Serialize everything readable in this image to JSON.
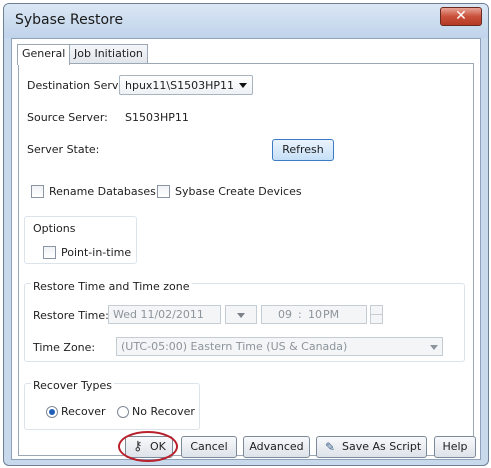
{
  "window": {
    "title": "Sybase Restore"
  },
  "tabs": [
    {
      "label": "General"
    },
    {
      "label": "Job Initiation"
    }
  ],
  "destination": {
    "label": "Destination Server:",
    "value": "hpux11\\S1503HP11"
  },
  "source": {
    "label": "Source Server:",
    "value": "S1503HP11"
  },
  "state": {
    "label": "Server State:",
    "refresh_label": "Refresh"
  },
  "checks": {
    "rename_databases": {
      "label": "Rename Databases",
      "checked": false
    },
    "create_devices": {
      "label": "Sybase Create Devices",
      "checked": false
    }
  },
  "options": {
    "title": "Options",
    "point_in_time": {
      "label": "Point-in-time",
      "checked": false
    }
  },
  "restore_time_group": {
    "title": "Restore Time and Time zone",
    "restore_time_label": "Restore Time:",
    "date_value": "Wed 11/02/2011",
    "time_hour": "09",
    "time_separator": ":",
    "time_minute": "10",
    "time_ampm": "PM",
    "time_zone_label": "Time Zone:",
    "time_zone_value": "(UTC-05:00) Eastern Time (US & Canada)"
  },
  "recover_types": {
    "title": "Recover Types",
    "recover_label": "Recover",
    "no_recover_label": "No Recover",
    "selected": "Recover"
  },
  "buttons": {
    "ok": "OK",
    "cancel": "Cancel",
    "advanced": "Advanced",
    "save_script": "Save As Script",
    "help": "Help"
  }
}
